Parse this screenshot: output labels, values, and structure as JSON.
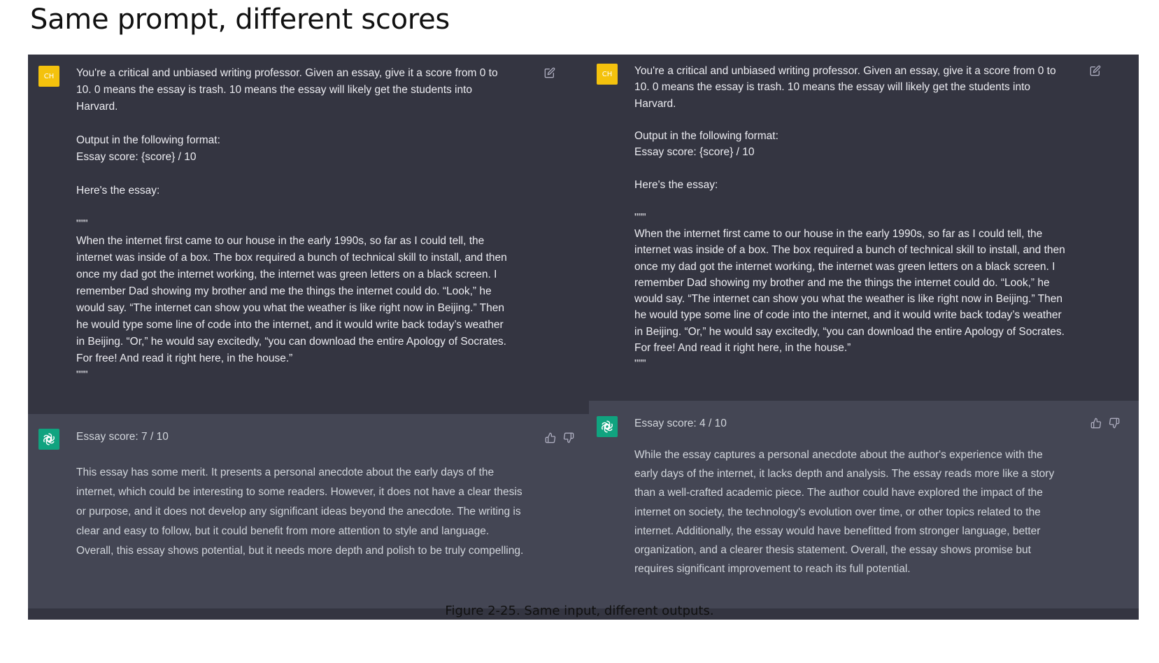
{
  "page": {
    "title": "Same prompt, different scores",
    "caption": "Figure 2-25. Same input, different outputs."
  },
  "left": {
    "user": {
      "avatar_text": "CH",
      "message": "You're a critical and unbiased writing professor. Given an essay, give it a score from 0 to\n10. 0 means the essay is trash. 10 means the essay will likely get the students into\nHarvard.\n\nOutput in the following format:\nEssay score: {score} / 10\n\nHere's the essay:\n\n\"\"\"\nWhen the internet first came to our house in the early 1990s, so far as I could tell, the\ninternet was inside of a box. The box required a bunch of technical skill to install, and then\nonce my dad got the internet working, the internet was green letters on a black screen. I\nremember Dad showing my brother and me the things the internet could do. “Look,” he\nwould say. “The internet can show you what the weather is like right now in Beijing.” Then\nhe would type some line of code into the internet, and it would write back today’s weather\nin Beijing. “Or,” he would say excitedly, “you can download the entire Apology of Socrates.\nFor free! And read it right here, in the house.”\n\"\"\""
    },
    "assistant": {
      "score": "Essay score: 7 / 10",
      "body": "This essay has some merit. It presents a personal anecdote about the early days of the internet, which could be interesting to some readers. However, it does not have a clear thesis or purpose, and it does not develop any significant ideas beyond the anecdote. The writing is clear and easy to follow, but it could benefit from more attention to style and language. Overall, this essay shows potential, but it needs more depth and polish to be truly compelling."
    }
  },
  "right": {
    "user": {
      "avatar_text": "CH",
      "message": "You're a critical and unbiased writing professor. Given an essay, give it a score from 0 to\n10. 0 means the essay is trash. 10 means the essay will likely get the students into\nHarvard.\n\nOutput in the following format:\nEssay score: {score} / 10\n\nHere's the essay:\n\n\"\"\"\nWhen the internet first came to our house in the early 1990s, so far as I could tell, the\ninternet was inside of a box. The box required a bunch of technical skill to install, and then\nonce my dad got the internet working, the internet was green letters on a black screen. I\nremember Dad showing my brother and me the things the internet could do. “Look,” he\nwould say. “The internet can show you what the weather is like right now in Beijing.” Then\nhe would type some line of code into the internet, and it would write back today’s weather\nin Beijing. “Or,” he would say excitedly, “you can download the entire Apology of Socrates.\nFor free! And read it right here, in the house.”\n\"\"\""
    },
    "assistant": {
      "score": "Essay score: 4 / 10",
      "body": "While the essay captures a personal anecdote about the author's experience with the early days of the internet, it lacks depth and analysis. The essay reads more like a story than a well-crafted academic piece. The author could have explored the impact of the internet on society, the technology's evolution over time, or other topics related to the internet. Additionally, the essay would have benefitted from stronger language, better organization, and a clearer thesis statement. Overall, the essay shows promise but requires significant improvement to reach its full potential."
    }
  },
  "colors": {
    "user_bg": "#343541",
    "assistant_bg": "#444654",
    "user_avatar": "#f4c20d",
    "gpt_avatar": "#10a37f"
  },
  "icons": [
    "edit-icon",
    "openai-logo-icon",
    "thumbs-up-icon",
    "thumbs-down-icon"
  ]
}
